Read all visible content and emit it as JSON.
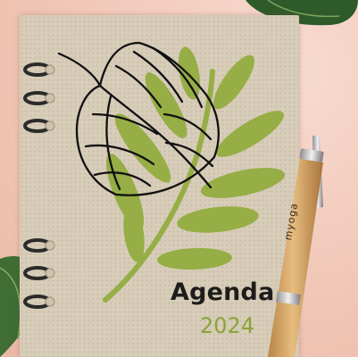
{
  "cover": {
    "title": "Agenda",
    "year": "2024"
  },
  "pen": {
    "brand": "myoga"
  },
  "colors": {
    "background": "#f3cdbf",
    "notebook_kraft": "#d8cdb9",
    "leaf_green": "#96ae45",
    "year_green": "#8aa33a",
    "pen_wood": "#d8a868",
    "title_dark": "#1d1d1b"
  },
  "icons": [
    "spiral-ring-icon",
    "leaf-illustration-icon",
    "ballpoint-pen-icon"
  ]
}
